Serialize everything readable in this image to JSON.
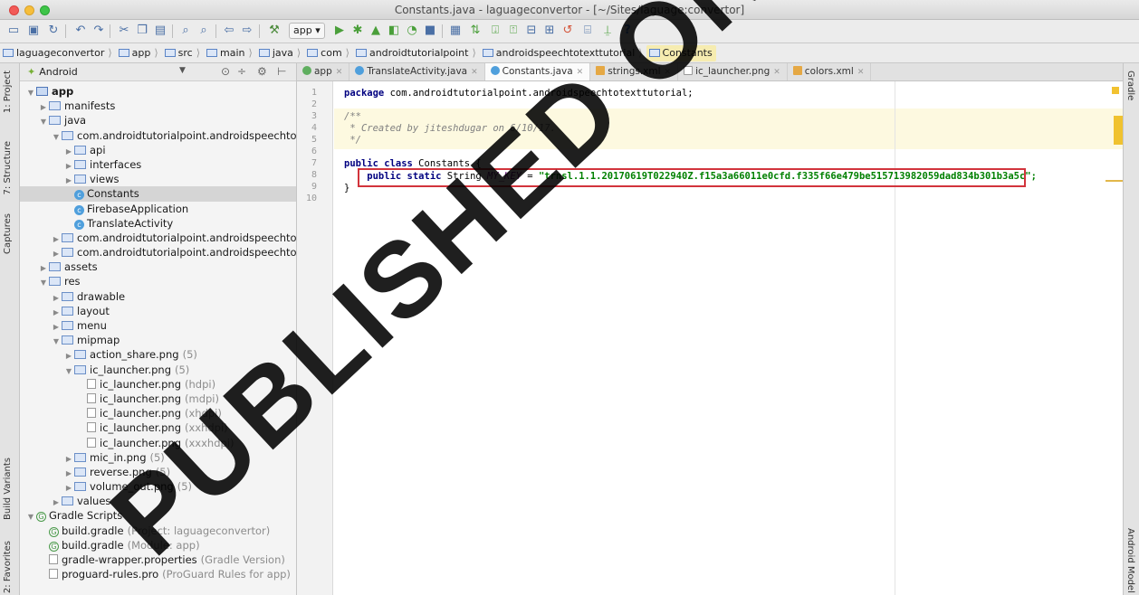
{
  "window": {
    "title": "Constants.java - laguageconvertor - [~/Sites/laguage:convertor]"
  },
  "toolbar": {
    "run_config": "app ▾",
    "help": "?"
  },
  "breadcrumbs": [
    "laguageconvertor",
    "app",
    "src",
    "main",
    "java",
    "com",
    "androidtutorialpoint",
    "androidspeechtotexttutorial",
    "Constants"
  ],
  "project_panel": {
    "view_selector": "Android",
    "tree": [
      {
        "depth": 0,
        "tri": "▼",
        "icon": "module",
        "label": "app",
        "bold": true
      },
      {
        "depth": 1,
        "tri": "▶",
        "icon": "folder",
        "label": "manifests"
      },
      {
        "depth": 1,
        "tri": "▼",
        "icon": "folder",
        "label": "java"
      },
      {
        "depth": 2,
        "tri": "▼",
        "icon": "folder",
        "label": "com.androidtutorialpoint.androidspeechto"
      },
      {
        "depth": 3,
        "tri": "▶",
        "icon": "folder",
        "label": "api"
      },
      {
        "depth": 3,
        "tri": "▶",
        "icon": "folder",
        "label": "interfaces"
      },
      {
        "depth": 3,
        "tri": "▶",
        "icon": "folder",
        "label": "views"
      },
      {
        "depth": 3,
        "tri": "",
        "icon": "class",
        "label": "Constants",
        "selected": true
      },
      {
        "depth": 3,
        "tri": "",
        "icon": "class",
        "label": "FirebaseApplication"
      },
      {
        "depth": 3,
        "tri": "",
        "icon": "class",
        "label": "TranslateActivity"
      },
      {
        "depth": 2,
        "tri": "▶",
        "icon": "folder",
        "label": "com.androidtutorialpoint.androidspeechto"
      },
      {
        "depth": 2,
        "tri": "▶",
        "icon": "folder",
        "label": "com.androidtutorialpoint.androidspeechto"
      },
      {
        "depth": 1,
        "tri": "▶",
        "icon": "folder",
        "label": "assets"
      },
      {
        "depth": 1,
        "tri": "▼",
        "icon": "folder",
        "label": "res"
      },
      {
        "depth": 2,
        "tri": "▶",
        "icon": "folder",
        "label": "drawable"
      },
      {
        "depth": 2,
        "tri": "▶",
        "icon": "folder",
        "label": "layout"
      },
      {
        "depth": 2,
        "tri": "▶",
        "icon": "folder",
        "label": "menu"
      },
      {
        "depth": 2,
        "tri": "▼",
        "icon": "folder",
        "label": "mipmap"
      },
      {
        "depth": 3,
        "tri": "▶",
        "icon": "folder",
        "label": "action_share.png",
        "dim": "(5)"
      },
      {
        "depth": 3,
        "tri": "▼",
        "icon": "folder",
        "label": "ic_launcher.png",
        "dim": "(5)"
      },
      {
        "depth": 4,
        "tri": "",
        "icon": "image",
        "label": "ic_launcher.png",
        "dim": "(hdpi)"
      },
      {
        "depth": 4,
        "tri": "",
        "icon": "image",
        "label": "ic_launcher.png",
        "dim": "(mdpi)"
      },
      {
        "depth": 4,
        "tri": "",
        "icon": "image",
        "label": "ic_launcher.png",
        "dim": "(xhdpi)"
      },
      {
        "depth": 4,
        "tri": "",
        "icon": "image",
        "label": "ic_launcher.png",
        "dim": "(xxhdpi)"
      },
      {
        "depth": 4,
        "tri": "",
        "icon": "image",
        "label": "ic_launcher.png",
        "dim": "(xxxhdpi)"
      },
      {
        "depth": 3,
        "tri": "▶",
        "icon": "folder",
        "label": "mic_in.png",
        "dim": "(5)"
      },
      {
        "depth": 3,
        "tri": "▶",
        "icon": "folder",
        "label": "reverse.png",
        "dim": "(5)"
      },
      {
        "depth": 3,
        "tri": "▶",
        "icon": "folder",
        "label": "volume_out.png",
        "dim": "(5)"
      },
      {
        "depth": 2,
        "tri": "▶",
        "icon": "folder",
        "label": "values"
      },
      {
        "depth": 0,
        "tri": "▼",
        "icon": "gradle",
        "label": "Gradle Scripts"
      },
      {
        "depth": 1,
        "tri": "",
        "icon": "gradle",
        "label": "build.gradle",
        "dim": "(Project: laguageconvertor)"
      },
      {
        "depth": 1,
        "tri": "",
        "icon": "gradle",
        "label": "build.gradle",
        "dim": "(Module: app)"
      },
      {
        "depth": 1,
        "tri": "",
        "icon": "image",
        "label": "gradle-wrapper.properties",
        "dim": "(Gradle Version)"
      },
      {
        "depth": 1,
        "tri": "",
        "icon": "image",
        "label": "proguard-rules.pro",
        "dim": "(ProGuard Rules for app)"
      }
    ]
  },
  "left_tabs": [
    "1: Project",
    "7: Structure",
    "Captures",
    "Build Variants",
    "2: Favorites"
  ],
  "right_tabs": [
    "Gradle",
    "Android Model"
  ],
  "editor_tabs": [
    {
      "label": "app",
      "type": "gradle"
    },
    {
      "label": "TranslateActivity.java",
      "type": "class"
    },
    {
      "label": "Constants.java",
      "type": "class",
      "active": true
    },
    {
      "label": "strings.xml",
      "type": "xml"
    },
    {
      "label": "ic_launcher.png",
      "type": "img"
    },
    {
      "label": "colors.xml",
      "type": "xml"
    }
  ],
  "editor": {
    "line_numbers": [
      "1",
      "2",
      "3",
      "4",
      "5",
      "6",
      "7",
      "8",
      "9",
      "10"
    ],
    "package_kw": "package",
    "package_name": " com.androidtutorialpoint.androidspeechtotexttutorial;",
    "comment_open": "/**",
    "comment_body": " * Created by jiteshdugar on 6/10/17.",
    "comment_close": " */",
    "class_kw": "public class",
    "class_name": " Constants {",
    "field_mods": "    public static",
    "field_type": " String ",
    "field_name": "MY_KEY",
    "field_eq": " = ",
    "field_value": "\"trnsl.1.1.20170619T022940Z.f15a3a66011e0cfd.f335f66e479be515713982059dad834b301b3a5c\";",
    "class_close": "}"
  },
  "watermark": "PUBLISHED ON CODELIST.CC",
  "colors": {
    "highlight_box": "#d2343c",
    "watermark": "#000000"
  }
}
